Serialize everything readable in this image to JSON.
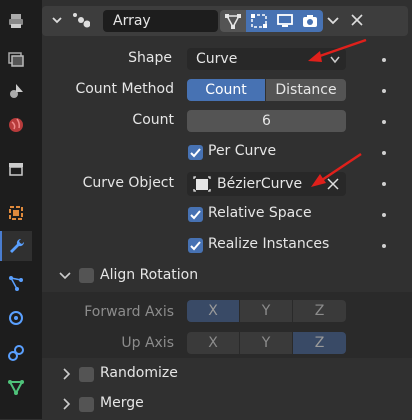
{
  "modifier": {
    "name": "Array"
  },
  "shape": {
    "label": "Shape",
    "value": "Curve"
  },
  "count_method": {
    "label": "Count Method",
    "options": [
      "Count",
      "Distance"
    ],
    "selected": "Count"
  },
  "count": {
    "label": "Count",
    "value": "6"
  },
  "per_curve": {
    "label": "Per Curve",
    "checked": true
  },
  "curve_object": {
    "label": "Curve Object",
    "value": "BézierCurve"
  },
  "relative_space": {
    "label": "Relative Space",
    "checked": true
  },
  "realize_instances": {
    "label": "Realize Instances",
    "checked": true
  },
  "align_rotation": {
    "label": "Align Rotation",
    "checked": false,
    "expanded": true
  },
  "forward_axis": {
    "label": "Forward Axis",
    "options": [
      "X",
      "Y",
      "Z"
    ],
    "selected": "X"
  },
  "up_axis": {
    "label": "Up Axis",
    "options": [
      "X",
      "Y",
      "Z"
    ],
    "selected": "Z"
  },
  "randomize": {
    "label": "Randomize",
    "checked": false
  },
  "merge": {
    "label": "Merge",
    "checked": false
  },
  "colors": {
    "accent": "#4772b3",
    "annotation_arrow": "#e0201b"
  }
}
